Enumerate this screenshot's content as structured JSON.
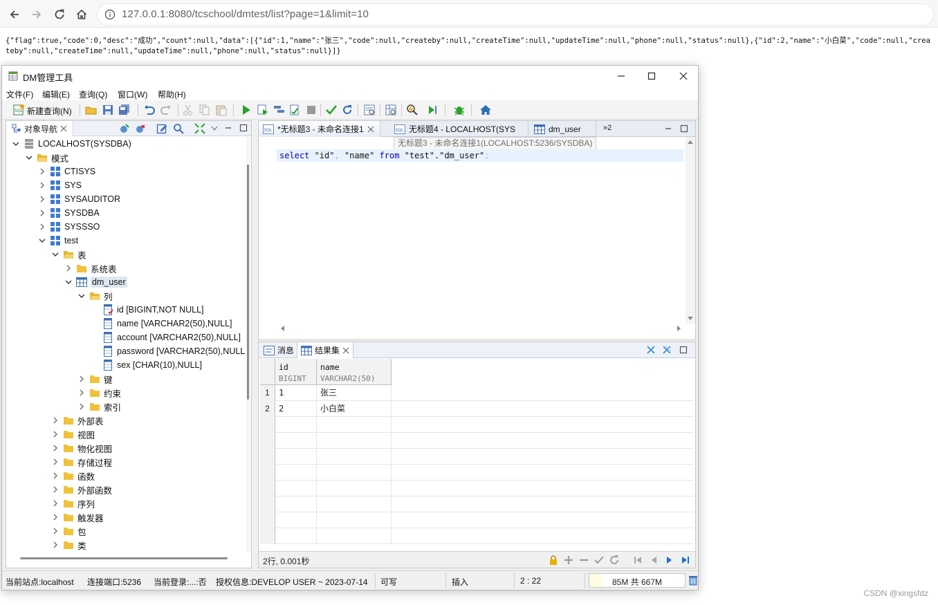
{
  "browser": {
    "url": "127.0.0.1:8080/tcschool/dmtest/list?page=1&limit=10",
    "response_text": "{\"flag\":true,\"code\":0,\"desc\":\"成功\",\"count\":null,\"data\":[{\"id\":1,\"name\":\"张三\",\"code\":null,\"createby\":null,\"createTime\":null,\"updateTime\":null,\"phone\":null,\"status\":null},{\"id\":2,\"name\":\"小白菜\",\"code\":null,\"createby\":null,\"createTime\":null,\"updateTime\":null,\"phone\":null,\"status\":null}]}"
  },
  "app": {
    "title": "DM管理工具",
    "menu": [
      "文件(F)",
      "编辑(E)",
      "查询(Q)",
      "窗口(W)",
      "帮助(H)"
    ],
    "toolbar": {
      "new_query_label": "新建查询(N)"
    }
  },
  "navigator": {
    "tab_label": "对象导航",
    "tree": [
      {
        "label": "LOCALHOST(SYSDBA)",
        "icon": "server-icon",
        "expand": "open"
      },
      {
        "label": "模式",
        "icon": "folder-open-icon",
        "expand": "open"
      },
      {
        "label": "CTISYS",
        "icon": "schema-icon",
        "expand": "closed"
      },
      {
        "label": "SYS",
        "icon": "schema-icon",
        "expand": "closed"
      },
      {
        "label": "SYSAUDITOR",
        "icon": "schema-icon",
        "expand": "closed"
      },
      {
        "label": "SYSDBA",
        "icon": "schema-icon",
        "expand": "closed"
      },
      {
        "label": "SYSSSO",
        "icon": "schema-icon",
        "expand": "closed"
      },
      {
        "label": "test",
        "icon": "schema-icon",
        "expand": "open"
      },
      {
        "label": "表",
        "icon": "folder-open-icon",
        "expand": "open"
      },
      {
        "label": "系统表",
        "icon": "folder-icon",
        "expand": "closed"
      },
      {
        "label": "dm_user",
        "icon": "table-icon",
        "expand": "open",
        "selected": true
      },
      {
        "label": "列",
        "icon": "folder-open-icon",
        "expand": "open"
      },
      {
        "label": "id [BIGINT,NOT NULL]",
        "icon": "key-column-icon",
        "expand": "none"
      },
      {
        "label": "name [VARCHAR2(50),NULL]",
        "icon": "column-icon",
        "expand": "none"
      },
      {
        "label": "account [VARCHAR2(50),NULL]",
        "icon": "column-icon",
        "expand": "none"
      },
      {
        "label": "password [VARCHAR2(50),NULL",
        "icon": "column-icon",
        "expand": "none"
      },
      {
        "label": "sex [CHAR(10),NULL]",
        "icon": "column-icon",
        "expand": "none"
      },
      {
        "label": "键",
        "icon": "folder-icon",
        "expand": "closed"
      },
      {
        "label": "约束",
        "icon": "folder-icon",
        "expand": "closed"
      },
      {
        "label": "索引",
        "icon": "folder-icon",
        "expand": "closed"
      },
      {
        "label": "外部表",
        "icon": "folder-icon",
        "expand": "closed"
      },
      {
        "label": "视图",
        "icon": "folder-icon",
        "expand": "closed"
      },
      {
        "label": "物化视图",
        "icon": "folder-icon",
        "expand": "closed"
      },
      {
        "label": "存储过程",
        "icon": "folder-icon",
        "expand": "closed"
      },
      {
        "label": "函数",
        "icon": "folder-icon",
        "expand": "closed"
      },
      {
        "label": "外部函数",
        "icon": "folder-icon",
        "expand": "closed"
      },
      {
        "label": "序列",
        "icon": "folder-icon",
        "expand": "closed"
      },
      {
        "label": "触发器",
        "icon": "folder-icon",
        "expand": "closed"
      },
      {
        "label": "包",
        "icon": "folder-icon",
        "expand": "closed"
      },
      {
        "label": "类",
        "icon": "folder-icon",
        "expand": "closed"
      }
    ]
  },
  "editor": {
    "tabs": [
      {
        "label": "*无标题3 - 未命名连接1",
        "icon": "sql-icon",
        "active": true,
        "closable": true
      },
      {
        "label": "无标题4 - LOCALHOST(SYS",
        "icon": "sql-icon",
        "active": false
      },
      {
        "label": "dm_user",
        "icon": "table-icon",
        "active": false
      }
    ],
    "overflow_label": "»2",
    "tooltip": "无标题3 - 未命名连接1(LOCALHOST:5236/SYSDBA)",
    "code": {
      "k1": "select",
      "t1": " \"id\"",
      "d1": ",",
      "t2": " \"name\" ",
      "k2": "from",
      "t3": " \"test\".\"dm_user\"",
      "d2": ";"
    }
  },
  "results": {
    "tabs": [
      {
        "label": "消息",
        "icon": "message-icon"
      },
      {
        "label": "结果集",
        "icon": "grid-icon",
        "active": true
      }
    ],
    "columns": [
      {
        "name": "id",
        "type": "BIGINT"
      },
      {
        "name": "name",
        "type": "VARCHAR2(50)"
      }
    ],
    "rows": [
      {
        "num": "1",
        "id": "1",
        "name": "张三"
      },
      {
        "num": "2",
        "id": "2",
        "name": "小白菜"
      }
    ],
    "summary": "2行, 0.001秒"
  },
  "status": {
    "site": "当前站点:localhost",
    "port": "连接端口:5236",
    "login": "当前登录:...:否",
    "license": "授权信息:DEVELOP USER ~ 2023-07-14",
    "writable": "可写",
    "insert_mode": "插入",
    "cursor": "2 : 22",
    "memory": "85M 共 667M",
    "memory_used_fraction": 0.127
  },
  "watermark": "CSDN @xingsfdz"
}
